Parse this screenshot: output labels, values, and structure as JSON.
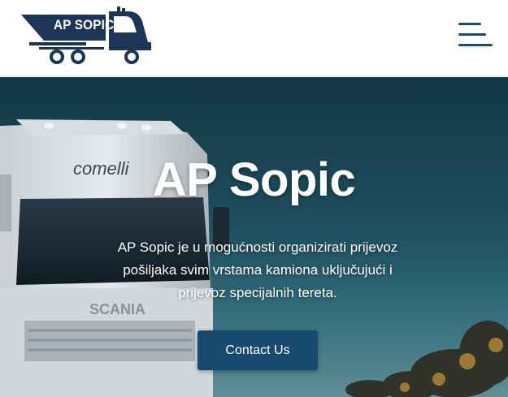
{
  "header": {
    "logo_text": "AP SOPIC",
    "menu_icon": "hamburger-menu-icon"
  },
  "hero": {
    "title": "AP Sopic",
    "description": "AP Sopic je u mogućnosti organizirati prijevoz pošiljaka svim vrstama kamiona uključujući i prijevoz specijalnih tereta.",
    "cta_label": "Contact Us",
    "truck_brand": "comelli",
    "truck_badge": "SCANIA"
  },
  "colors": {
    "brand_navy": "#1d3557",
    "cta_blue": "#174a6e",
    "menu_blue": "#1d4b6b",
    "sky": "#1f4e5e"
  }
}
